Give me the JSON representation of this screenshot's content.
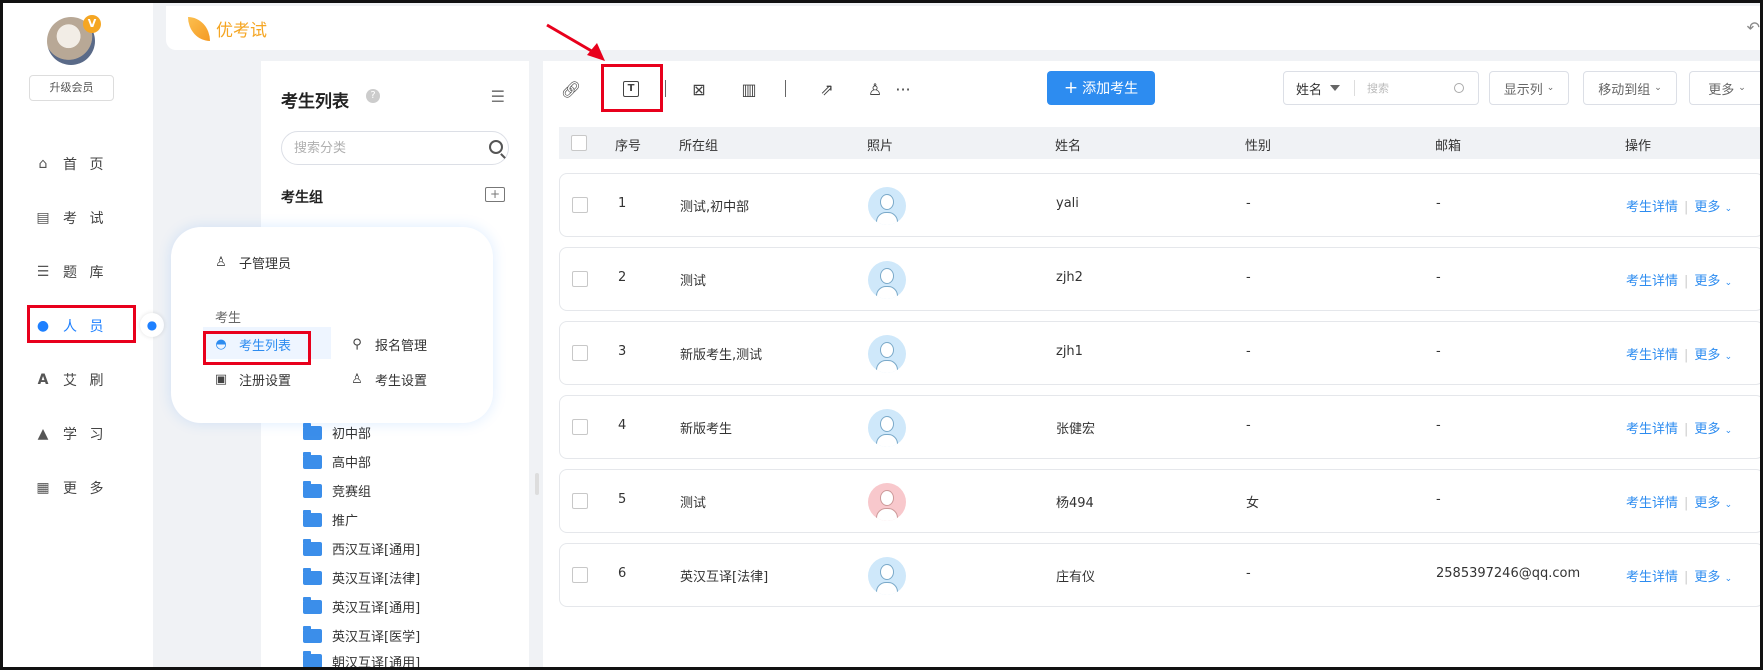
{
  "nav": {
    "upgrade_label": "升级会员",
    "items": [
      {
        "label": "首 页",
        "icon": "home-icon"
      },
      {
        "label": "考 试",
        "icon": "exam-icon"
      },
      {
        "label": "题 库",
        "icon": "question-bank-icon"
      },
      {
        "label": "人 员",
        "icon": "user-icon"
      },
      {
        "label": "艾 刷",
        "icon": "font-icon"
      },
      {
        "label": "学 习",
        "icon": "graduation-cap-icon"
      },
      {
        "label": "更 多",
        "icon": "apps-icon"
      }
    ],
    "active_index": 3
  },
  "header": {
    "logo_text": "优考试"
  },
  "category": {
    "title": "考生列表",
    "search_placeholder": "搜索分类",
    "group_label": "考生组",
    "folders": [
      "初中部",
      "高中部",
      "竞赛组",
      "推广",
      "西汉互译[通用]",
      "英汉互译[法律]",
      "英汉互译[通用]",
      "英汉互译[医学]",
      "朝汉互译[通用]"
    ]
  },
  "popup": {
    "sub_admin": "子管理员",
    "section_label": "考生",
    "student_list": "考生列表",
    "registration_mgmt": "报名管理",
    "registration_settings": "注册设置",
    "student_settings": "考生设置"
  },
  "toolbar": {
    "add_button": "添加考生",
    "add_prefix": "+",
    "more_dots": "···",
    "search_field": "姓名",
    "search_placeholder": "搜索",
    "show_columns": "显示列",
    "move_to_group": "移动到组",
    "more": "更多"
  },
  "table": {
    "headers": {
      "index": "序号",
      "group": "所在组",
      "photo": "照片",
      "name": "姓名",
      "gender": "性别",
      "email": "邮箱",
      "action": "操作"
    },
    "detail_label": "考生详情",
    "more_label": "更多",
    "rows": [
      {
        "index": "1",
        "group": "测试,初中部",
        "name": "yali",
        "gender": "-",
        "email": "-",
        "photo": "male"
      },
      {
        "index": "2",
        "group": "测试",
        "name": "zjh2",
        "gender": "-",
        "email": "-",
        "photo": "male"
      },
      {
        "index": "3",
        "group": "新版考生,测试",
        "name": "zjh1",
        "gender": "-",
        "email": "-",
        "photo": "male"
      },
      {
        "index": "4",
        "group": "新版考生",
        "name": "张健宏",
        "gender": "-",
        "email": "-",
        "photo": "male"
      },
      {
        "index": "5",
        "group": "测试",
        "name": "杨494",
        "gender": "女",
        "email": "-",
        "photo": "female"
      },
      {
        "index": "6",
        "group": "英汉互译[法律]",
        "name": "庄有仪",
        "gender": "-",
        "email": "2585397246@qq.com",
        "photo": "male"
      }
    ]
  },
  "colors": {
    "accent": "#2d8cf0",
    "highlight": "#e8001c",
    "logo": "#f5a623"
  }
}
